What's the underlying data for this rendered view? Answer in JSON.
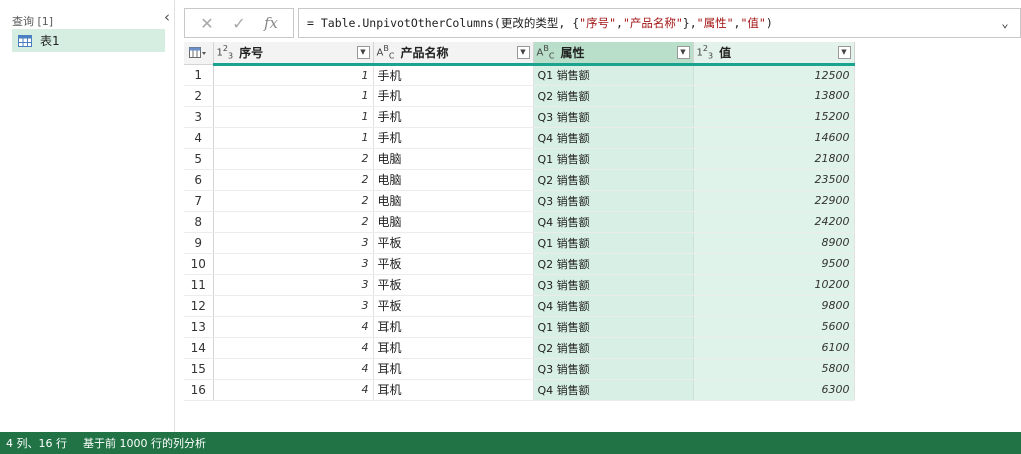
{
  "queries_pane": {
    "header": "查询 [1]",
    "items": [
      {
        "label": "表1",
        "icon": "table-icon"
      }
    ]
  },
  "formula_bar": {
    "cancel_icon": "✕",
    "confirm_icon": "✓",
    "fx_label": "fx",
    "formula_prefix": "= Table.UnpivotOtherColumns(更改的类型, {",
    "str1": "\"序号\"",
    "sep1": ", ",
    "str2": "\"产品名称\"",
    "mid": "}, ",
    "str3": "\"属性\"",
    "sep2": ", ",
    "str4": "\"值\"",
    "suffix": ")"
  },
  "grid": {
    "columns": [
      {
        "label": "序号",
        "type_icon": "123"
      },
      {
        "label": "产品名称",
        "type_icon": "ABC"
      },
      {
        "label": "属性",
        "type_icon": "ABC"
      },
      {
        "label": "值",
        "type_icon": "123"
      }
    ],
    "rows": [
      {
        "n": "1",
        "a": "1",
        "b": "手机",
        "c": "Q1 销售额",
        "d": "12500"
      },
      {
        "n": "2",
        "a": "1",
        "b": "手机",
        "c": "Q2 销售额",
        "d": "13800"
      },
      {
        "n": "3",
        "a": "1",
        "b": "手机",
        "c": "Q3 销售额",
        "d": "15200"
      },
      {
        "n": "4",
        "a": "1",
        "b": "手机",
        "c": "Q4 销售额",
        "d": "14600"
      },
      {
        "n": "5",
        "a": "2",
        "b": "电脑",
        "c": "Q1 销售额",
        "d": "21800"
      },
      {
        "n": "6",
        "a": "2",
        "b": "电脑",
        "c": "Q2 销售额",
        "d": "23500"
      },
      {
        "n": "7",
        "a": "2",
        "b": "电脑",
        "c": "Q3 销售额",
        "d": "22900"
      },
      {
        "n": "8",
        "a": "2",
        "b": "电脑",
        "c": "Q4 销售额",
        "d": "24200"
      },
      {
        "n": "9",
        "a": "3",
        "b": "平板",
        "c": "Q1 销售额",
        "d": "8900"
      },
      {
        "n": "10",
        "a": "3",
        "b": "平板",
        "c": "Q2 销售额",
        "d": "9500"
      },
      {
        "n": "11",
        "a": "3",
        "b": "平板",
        "c": "Q3 销售额",
        "d": "10200"
      },
      {
        "n": "12",
        "a": "3",
        "b": "平板",
        "c": "Q4 销售额",
        "d": "9800"
      },
      {
        "n": "13",
        "a": "4",
        "b": "耳机",
        "c": "Q1 销售额",
        "d": "5600"
      },
      {
        "n": "14",
        "a": "4",
        "b": "耳机",
        "c": "Q2 销售额",
        "d": "6100"
      },
      {
        "n": "15",
        "a": "4",
        "b": "耳机",
        "c": "Q3 销售额",
        "d": "5800"
      },
      {
        "n": "16",
        "a": "4",
        "b": "耳机",
        "c": "Q4 销售额",
        "d": "6300"
      }
    ]
  },
  "status_bar": {
    "summary": "4 列、16 行",
    "profile": "基于前 1000 行的列分析"
  },
  "colors": {
    "status_bar": "#217346",
    "header_accent": "#1aa38f",
    "selected_column": "#d7efe4",
    "selected_query": "#d6ede1"
  }
}
